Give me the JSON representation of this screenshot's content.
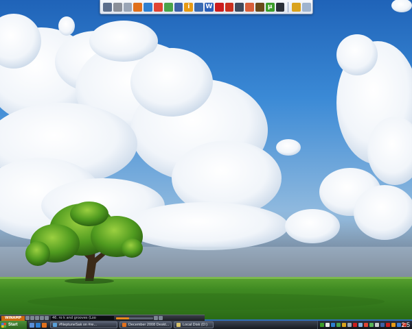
{
  "dock": {
    "icons": [
      {
        "name": "documents-icon",
        "color": "#5d6f8c"
      },
      {
        "name": "tools-icon",
        "color": "#8a8f99"
      },
      {
        "name": "mail-icon",
        "color": "#9aa5b6"
      },
      {
        "name": "firefox-icon",
        "color": "#e0701c"
      },
      {
        "name": "internet-explorer-icon",
        "color": "#2e7fd0"
      },
      {
        "name": "chrome-icon",
        "color": "#e04433"
      },
      {
        "name": "messenger-icon",
        "color": "#4aa34a"
      },
      {
        "name": "control-panel-icon",
        "color": "#3d62a8"
      },
      {
        "name": "info-icon",
        "color": "#e79a14",
        "glyph": "i"
      },
      {
        "name": "window-icon",
        "color": "#3a6bb2"
      },
      {
        "name": "word-icon",
        "color": "#2a5fb8",
        "glyph": "W"
      },
      {
        "name": "opera-icon",
        "color": "#cc1d1d"
      },
      {
        "name": "flash-icon",
        "color": "#c9301f"
      },
      {
        "name": "media-icon",
        "color": "#3f4a5c"
      },
      {
        "name": "image-editor-icon",
        "color": "#d85f3a"
      },
      {
        "name": "archive-icon",
        "color": "#6a4a1a"
      },
      {
        "name": "torrent-icon",
        "color": "#3b9d2a",
        "glyph": "μ"
      },
      {
        "name": "camera-icon",
        "color": "#2a2f38"
      }
    ],
    "extra_icons": [
      {
        "name": "network-icon",
        "color": "#d9a21c"
      },
      {
        "name": "recycle-bin-icon",
        "color": "#9fb4cf"
      }
    ]
  },
  "media_player": {
    "logo": "WINAMP",
    "track": "46. ro k and grooves (Loo",
    "progress": 0.35,
    "accent": "#e88a1c"
  },
  "taskbar": {
    "start_label": "Start",
    "quick_launch": [
      {
        "name": "show-desktop-icon",
        "color": "#5a8fd8"
      },
      {
        "name": "browser-ql-icon",
        "color": "#2e7fd0"
      },
      {
        "name": "player-ql-icon",
        "color": "#e0701c"
      }
    ],
    "tasks": [
      {
        "label": "#NeptuneSak on #re...",
        "icon_color": "#5aa0d8"
      },
      {
        "label": "December 2008 Deskt...",
        "icon_color": "#e0701c"
      },
      {
        "label": "Local Disk (D:)",
        "icon_color": "#d9c36b"
      }
    ],
    "tray_icons": [
      "#3b9d2a",
      "#e6e6e6",
      "#2e7fd0",
      "#4aa34a",
      "#d9a21c",
      "#9aa5b6",
      "#cc1d1d",
      "#7fb0e0",
      "#e04433",
      "#58b458",
      "#c8c8c8",
      "#3d62a8",
      "#cc1d1d",
      "#e79a14",
      "#3b7dd8",
      "#c9301f"
    ],
    "clock": "2:5"
  }
}
